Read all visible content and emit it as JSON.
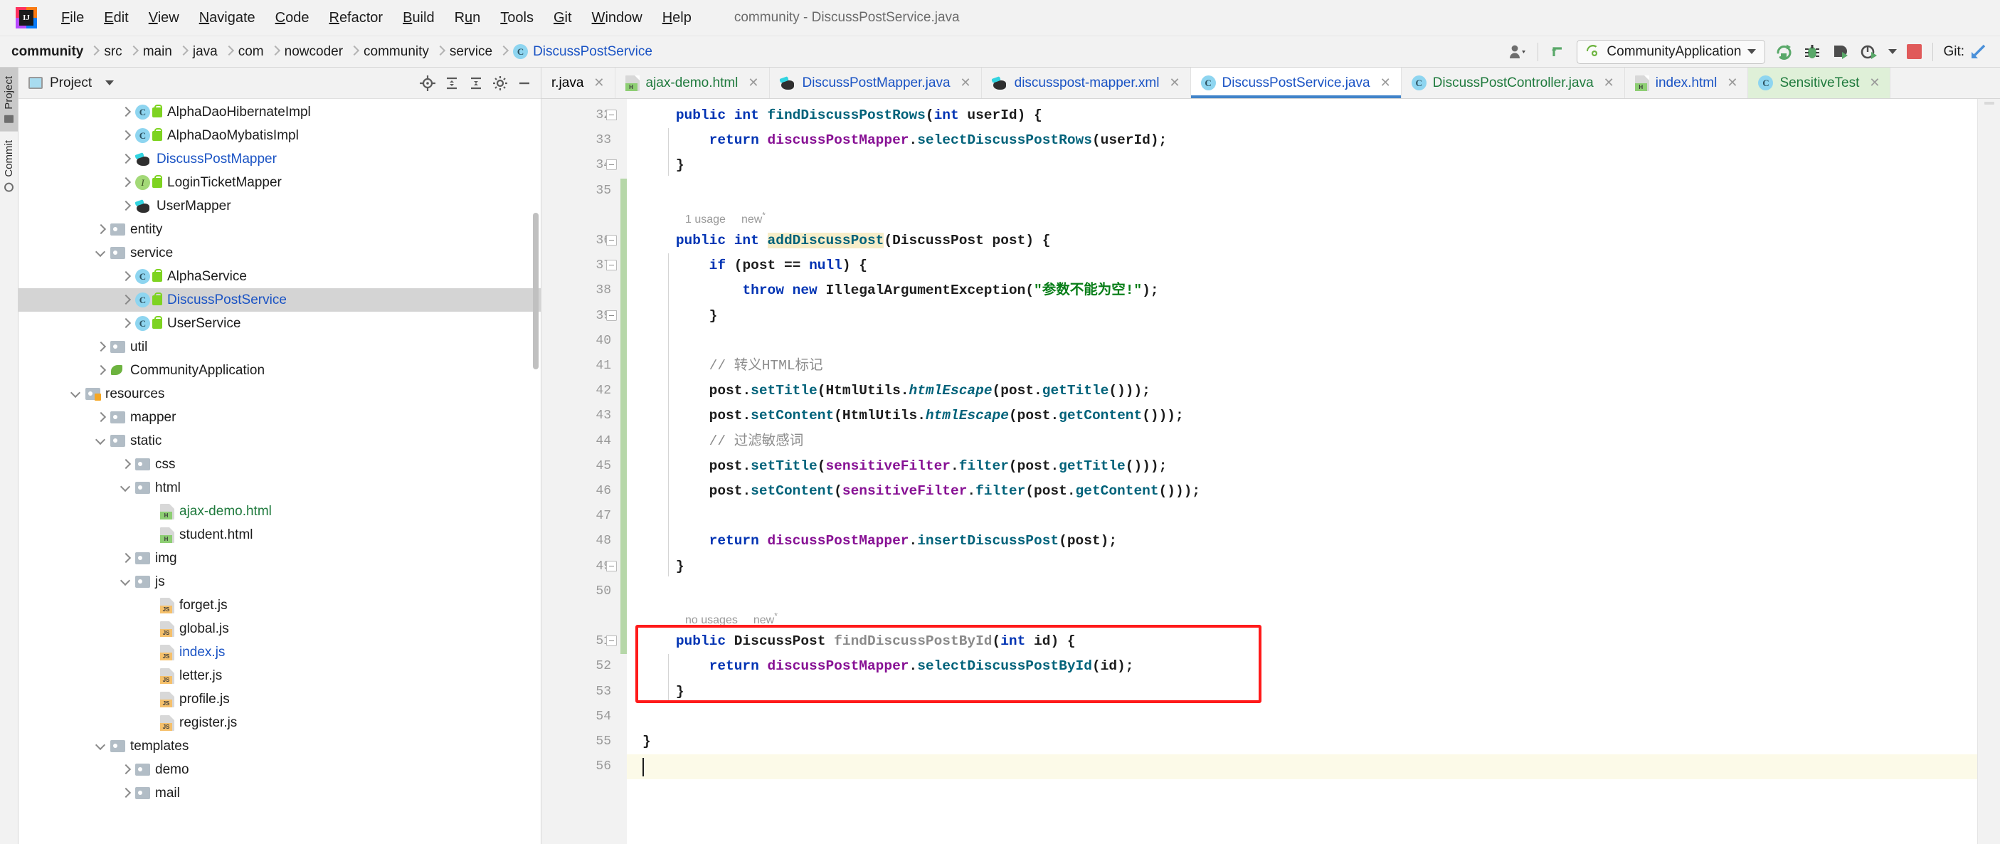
{
  "window": {
    "title": "community - DiscussPostService.java",
    "logo_icon": "intellij-idea-logo"
  },
  "menubar": {
    "items": [
      {
        "label": "File",
        "mnemonic": "F"
      },
      {
        "label": "Edit",
        "mnemonic": "E"
      },
      {
        "label": "View",
        "mnemonic": "V"
      },
      {
        "label": "Navigate",
        "mnemonic": "N"
      },
      {
        "label": "Code",
        "mnemonic": "C"
      },
      {
        "label": "Refactor",
        "mnemonic": "R"
      },
      {
        "label": "Build",
        "mnemonic": "B"
      },
      {
        "label": "Run",
        "mnemonic": "u"
      },
      {
        "label": "Tools",
        "mnemonic": "T"
      },
      {
        "label": "Git",
        "mnemonic": "G"
      },
      {
        "label": "Window",
        "mnemonic": "W"
      },
      {
        "label": "Help",
        "mnemonic": "H"
      }
    ]
  },
  "breadcrumb": {
    "items": [
      {
        "label": "community",
        "kind": "project"
      },
      {
        "label": "src",
        "kind": "dir"
      },
      {
        "label": "main",
        "kind": "dir"
      },
      {
        "label": "java",
        "kind": "dir"
      },
      {
        "label": "com",
        "kind": "package"
      },
      {
        "label": "nowcoder",
        "kind": "package"
      },
      {
        "label": "community",
        "kind": "package"
      },
      {
        "label": "service",
        "kind": "package"
      },
      {
        "label": "DiscussPostService",
        "kind": "class",
        "icon": "class-icon"
      }
    ]
  },
  "toolbar": {
    "user_icon": "user-dropdown-icon",
    "updates_icon": "pull-updates-icon",
    "run_config": "CommunityApplication",
    "run_config_icon": "spring-boot-icon",
    "rerun_icon": "rerun-icon",
    "debug_icon": "debug-icon",
    "run_with_coverage_icon": "run-coverage-icon",
    "profiler_icon": "profiler-icon",
    "stop_icon": "stop-icon",
    "git_label": "Git:",
    "git_update_icon": "git-update-project-icon",
    "accent_blue": "#4083c9",
    "stop_red": "#e05a5a",
    "run_green": "#59a869"
  },
  "toolwindows": {
    "left": [
      {
        "label": "Project",
        "icon": "project-folder-icon",
        "active": true
      },
      {
        "label": "Commit",
        "icon": "commit-icon",
        "active": false
      }
    ]
  },
  "project_panel": {
    "title": "Project",
    "title_icon": "project-window-icon",
    "dropdown_icon": "chevron-down-icon",
    "actions": [
      {
        "name": "locate-icon"
      },
      {
        "name": "expand-all-icon"
      },
      {
        "name": "collapse-all-icon"
      },
      {
        "name": "settings-gear-icon"
      },
      {
        "name": "hide-icon"
      }
    ],
    "tree": [
      {
        "label": "AlphaDaoHibernateImpl",
        "indent": 5,
        "twist": "right",
        "icon": "class-icon",
        "lock": true,
        "color": "dark"
      },
      {
        "label": "AlphaDaoMybatisImpl",
        "indent": 5,
        "twist": "right",
        "icon": "class-icon",
        "lock": true,
        "color": "dark"
      },
      {
        "label": "DiscussPostMapper",
        "indent": 5,
        "twist": "right",
        "icon": "mybatis-mapper-icon",
        "lock": false,
        "color": "blue"
      },
      {
        "label": "LoginTicketMapper",
        "indent": 5,
        "twist": "right",
        "icon": "interface-icon",
        "lock": true,
        "color": "dark"
      },
      {
        "label": "UserMapper",
        "indent": 5,
        "twist": "right",
        "icon": "mybatis-mapper-icon",
        "lock": false,
        "color": "dark"
      },
      {
        "label": "entity",
        "indent": 4,
        "twist": "right",
        "icon": "folder-icon",
        "color": "dark"
      },
      {
        "label": "service",
        "indent": 4,
        "twist": "down",
        "icon": "folder-icon",
        "color": "dark"
      },
      {
        "label": "AlphaService",
        "indent": 5,
        "twist": "right",
        "icon": "class-icon",
        "lock": true,
        "color": "dark"
      },
      {
        "label": "DiscussPostService",
        "indent": 5,
        "twist": "right",
        "icon": "class-icon",
        "lock": true,
        "color": "blue",
        "selected": true
      },
      {
        "label": "UserService",
        "indent": 5,
        "twist": "right",
        "icon": "class-icon",
        "lock": true,
        "color": "dark"
      },
      {
        "label": "util",
        "indent": 4,
        "twist": "right",
        "icon": "folder-icon",
        "color": "dark"
      },
      {
        "label": "CommunityApplication",
        "indent": 4,
        "twist": "right",
        "icon": "spring-boot-icon",
        "color": "dark"
      },
      {
        "label": "resources",
        "indent": 3,
        "twist": "down",
        "icon": "resources-folder-icon",
        "color": "dark"
      },
      {
        "label": "mapper",
        "indent": 4,
        "twist": "right",
        "icon": "folder-icon",
        "color": "dark"
      },
      {
        "label": "static",
        "indent": 4,
        "twist": "down",
        "icon": "folder-icon",
        "color": "dark"
      },
      {
        "label": "css",
        "indent": 5,
        "twist": "right",
        "icon": "folder-icon",
        "color": "dark"
      },
      {
        "label": "html",
        "indent": 5,
        "twist": "down",
        "icon": "folder-icon",
        "color": "dark"
      },
      {
        "label": "ajax-demo.html",
        "indent": 6,
        "twist": "none",
        "icon": "html-file-icon",
        "color": "green"
      },
      {
        "label": "student.html",
        "indent": 6,
        "twist": "none",
        "icon": "html-file-icon",
        "color": "dark"
      },
      {
        "label": "img",
        "indent": 5,
        "twist": "right",
        "icon": "folder-icon",
        "color": "dark"
      },
      {
        "label": "js",
        "indent": 5,
        "twist": "down",
        "icon": "folder-icon",
        "color": "dark"
      },
      {
        "label": "forget.js",
        "indent": 6,
        "twist": "none",
        "icon": "js-file-icon",
        "color": "dark"
      },
      {
        "label": "global.js",
        "indent": 6,
        "twist": "none",
        "icon": "js-file-icon",
        "color": "dark"
      },
      {
        "label": "index.js",
        "indent": 6,
        "twist": "none",
        "icon": "js-file-icon",
        "color": "blue"
      },
      {
        "label": "letter.js",
        "indent": 6,
        "twist": "none",
        "icon": "js-file-icon",
        "color": "dark"
      },
      {
        "label": "profile.js",
        "indent": 6,
        "twist": "none",
        "icon": "js-file-icon",
        "color": "dark"
      },
      {
        "label": "register.js",
        "indent": 6,
        "twist": "none",
        "icon": "js-file-icon",
        "color": "dark"
      },
      {
        "label": "templates",
        "indent": 4,
        "twist": "down",
        "icon": "folder-icon",
        "color": "dark"
      },
      {
        "label": "demo",
        "indent": 5,
        "twist": "right",
        "icon": "folder-icon",
        "color": "dark"
      },
      {
        "label": "mail",
        "indent": 5,
        "twist": "right",
        "icon": "folder-icon",
        "color": "dark"
      }
    ]
  },
  "editor_tabs": [
    {
      "label": "r.java",
      "icon": "java-class-icon",
      "color": "dark",
      "active": false,
      "clipped": true
    },
    {
      "label": "ajax-demo.html",
      "icon": "html-file-icon",
      "color": "green",
      "active": false
    },
    {
      "label": "DiscussPostMapper.java",
      "icon": "mybatis-mapper-icon",
      "color": "blue",
      "active": false
    },
    {
      "label": "discusspost-mapper.xml",
      "icon": "mybatis-mapper-icon",
      "color": "blue",
      "active": false
    },
    {
      "label": "DiscussPostService.java",
      "icon": "class-icon",
      "color": "blue",
      "active": true
    },
    {
      "label": "DiscussPostController.java",
      "icon": "class-icon",
      "color": "green",
      "active": false
    },
    {
      "label": "index.html",
      "icon": "html-file-icon",
      "color": "blue",
      "active": false
    },
    {
      "label": "SensitiveTest",
      "icon": "class-run-icon",
      "color": "green",
      "active": false,
      "greenbg": true
    }
  ],
  "editor": {
    "filename": "DiscussPostService.java",
    "first_line": 32,
    "last_line": 56,
    "line_numbers": [
      32,
      33,
      34,
      35,
      36,
      37,
      38,
      39,
      40,
      41,
      42,
      43,
      44,
      45,
      46,
      47,
      48,
      49,
      50,
      51,
      52,
      53,
      54,
      55,
      56
    ],
    "annotation_box": {
      "color": "#ff1a1a",
      "around": "findDiscussPostById-method"
    },
    "inlay_hints": [
      {
        "line": 35,
        "text": "1 usage",
        "extra": "new"
      },
      {
        "line": 50,
        "text": "no usages",
        "extra": "new"
      }
    ],
    "code_lines": [
      {
        "n": 32,
        "text": "    public int findDiscussPostRows(int userId) {"
      },
      {
        "n": 33,
        "text": "        return discussPostMapper.selectDiscussPostRows(userId);"
      },
      {
        "n": 34,
        "text": "    }"
      },
      {
        "n": 35,
        "text": ""
      },
      {
        "n": 36,
        "text": "    public int addDiscussPost(DiscussPost post) {"
      },
      {
        "n": 37,
        "text": "        if (post == null) {"
      },
      {
        "n": 38,
        "text": "            throw new IllegalArgumentException(\"参数不能为空!\");"
      },
      {
        "n": 39,
        "text": "        }"
      },
      {
        "n": 40,
        "text": ""
      },
      {
        "n": 41,
        "text": "        // 转义HTML标记"
      },
      {
        "n": 42,
        "text": "        post.setTitle(HtmlUtils.htmlEscape(post.getTitle()));"
      },
      {
        "n": 43,
        "text": "        post.setContent(HtmlUtils.htmlEscape(post.getContent()));"
      },
      {
        "n": 44,
        "text": "        // 过滤敏感词"
      },
      {
        "n": 45,
        "text": "        post.setTitle(sensitiveFilter.filter(post.getTitle()));"
      },
      {
        "n": 46,
        "text": "        post.setContent(sensitiveFilter.filter(post.getContent()));"
      },
      {
        "n": 47,
        "text": ""
      },
      {
        "n": 48,
        "text": "        return discussPostMapper.insertDiscussPost(post);"
      },
      {
        "n": 49,
        "text": "    }"
      },
      {
        "n": 50,
        "text": ""
      },
      {
        "n": 51,
        "text": "    public DiscussPost findDiscussPostById(int id) {"
      },
      {
        "n": 52,
        "text": "        return discussPostMapper.selectDiscussPostById(id);"
      },
      {
        "n": 53,
        "text": "    }"
      },
      {
        "n": 54,
        "text": ""
      },
      {
        "n": 55,
        "text": "}"
      },
      {
        "n": 56,
        "text": ""
      }
    ],
    "colors": {
      "keyword": "#0033b3",
      "method": "#00627a",
      "field": "#871094",
      "string": "#067d17",
      "comment": "#8c8c8c",
      "unused_gray": "#8a8a8a",
      "highlight_bg": "#f7edc8",
      "current_line_bg": "#fcfae8",
      "changebar_green": "#b6d7a8"
    }
  }
}
